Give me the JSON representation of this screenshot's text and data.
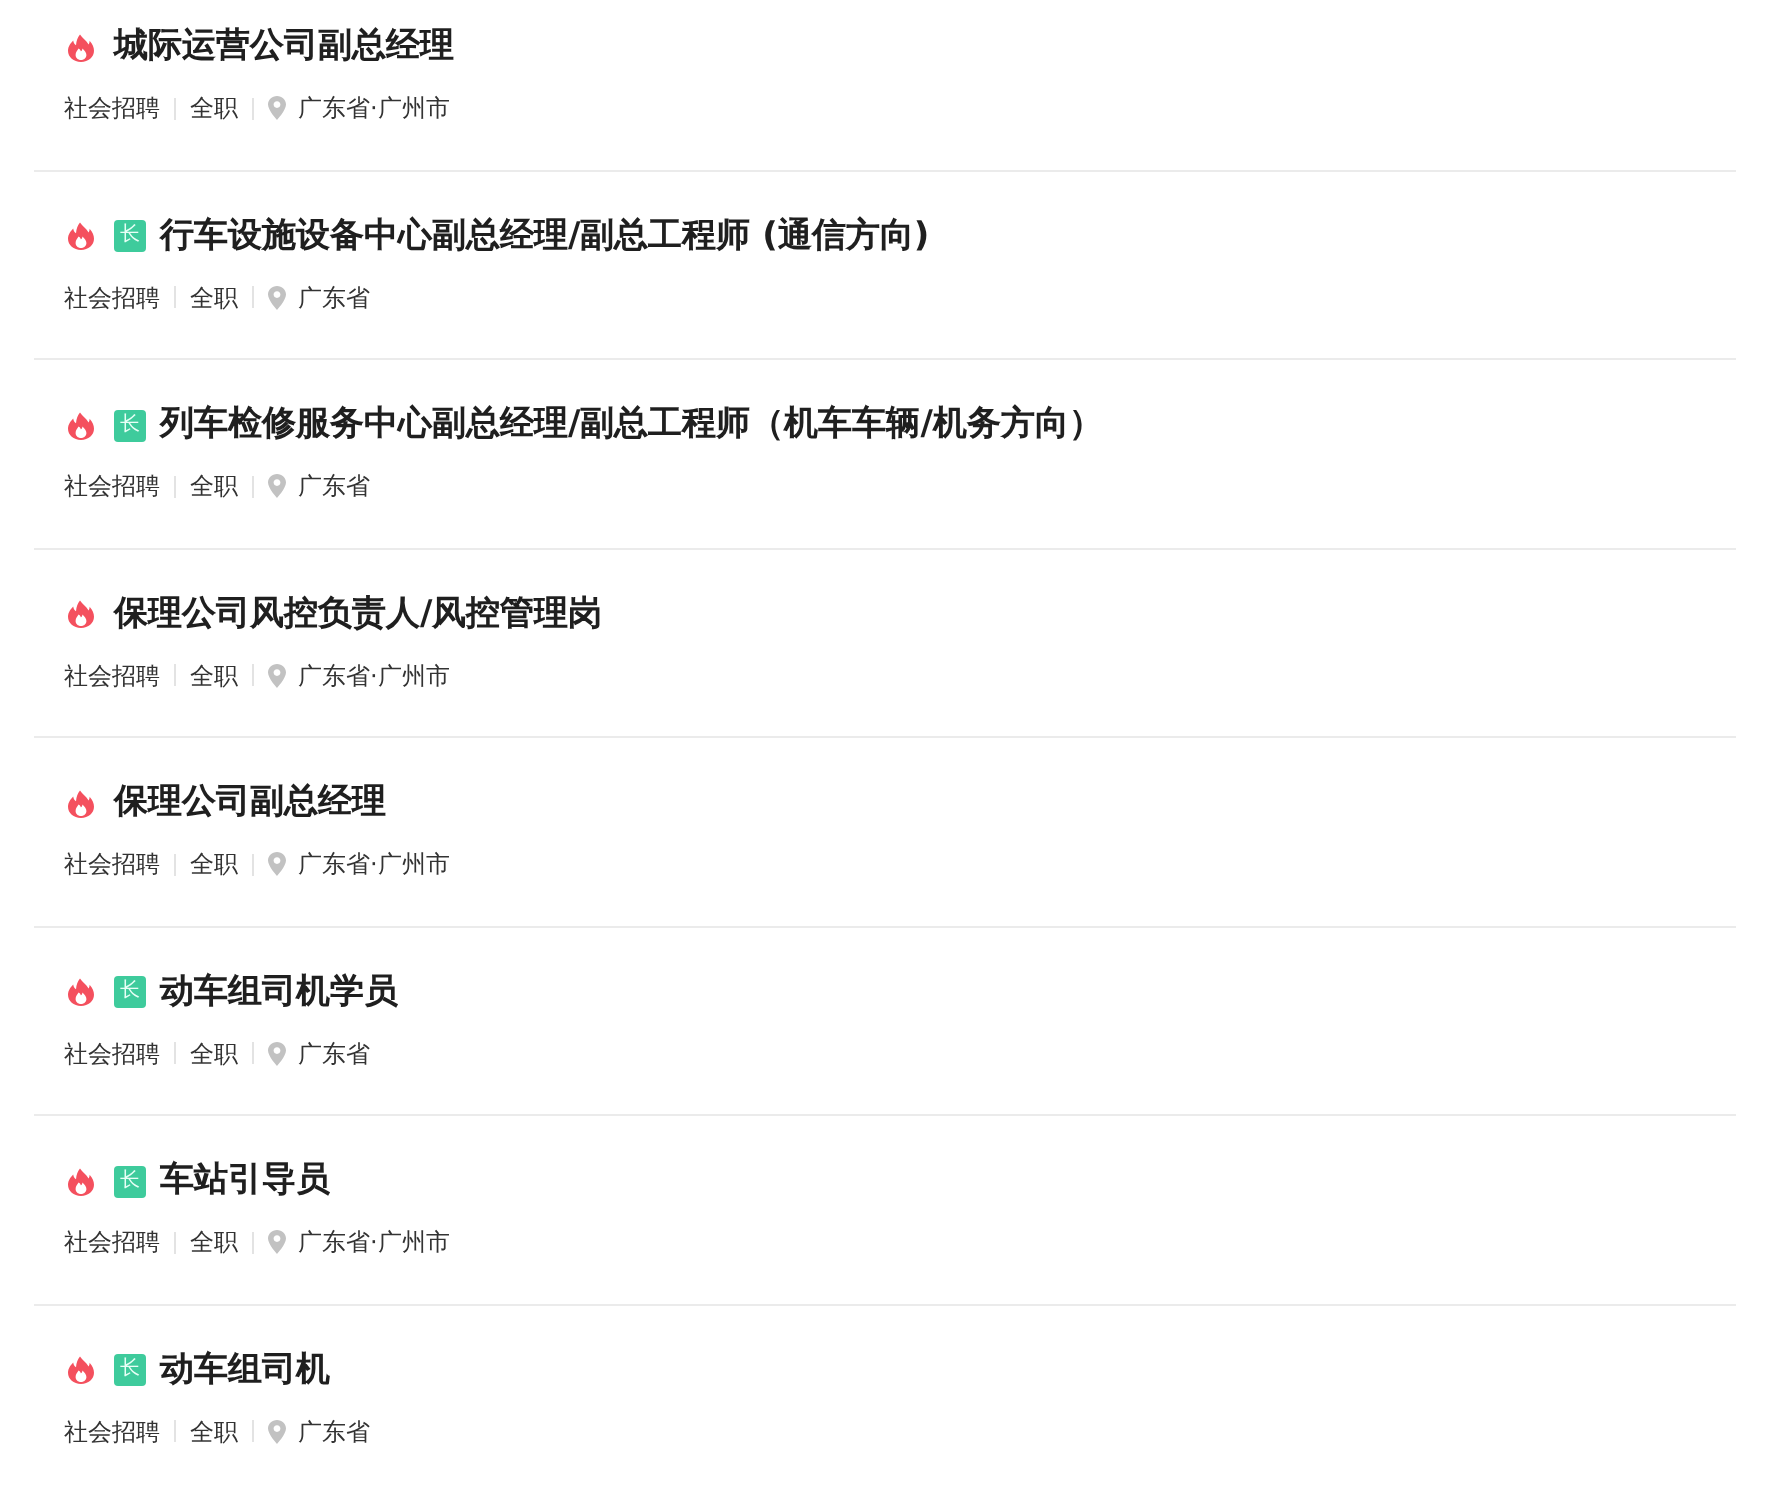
{
  "jobs": [
    {
      "title": "城际运营公司副总经理",
      "hot": true,
      "meta": [
        "社会招聘",
        "全职"
      ],
      "location": "广东省·广州市"
    },
    {
      "title": "行车设施设备中心副总经理/副总工程师 (通信方向)",
      "hot": true,
      "tag": "长",
      "meta": [
        "社会招聘",
        "全职"
      ],
      "location": "广东省"
    },
    {
      "title": "列车检修服务中心副总经理/副总工程师（机车车辆/机务方向）",
      "hot": true,
      "tag": "长",
      "meta": [
        "社会招聘",
        "全职"
      ],
      "location": "广东省"
    },
    {
      "title": "保理公司风控负责人/风控管理岗",
      "hot": true,
      "meta": [
        "社会招聘",
        "全职"
      ],
      "location": "广东省·广州市"
    },
    {
      "title": "保理公司副总经理",
      "hot": true,
      "meta": [
        "社会招聘",
        "全职"
      ],
      "location": "广东省·广州市"
    },
    {
      "title": "动车组司机学员",
      "hot": true,
      "tag": "长",
      "meta": [
        "社会招聘",
        "全职"
      ],
      "location": "广东省"
    },
    {
      "title": "车站引导员",
      "hot": true,
      "tag": "长",
      "meta": [
        "社会招聘",
        "全职"
      ],
      "location": "广东省·广州市"
    },
    {
      "title": "动车组司机",
      "hot": true,
      "tag": "长",
      "meta": [
        "社会招聘",
        "全职"
      ],
      "location": "广东省"
    }
  ]
}
